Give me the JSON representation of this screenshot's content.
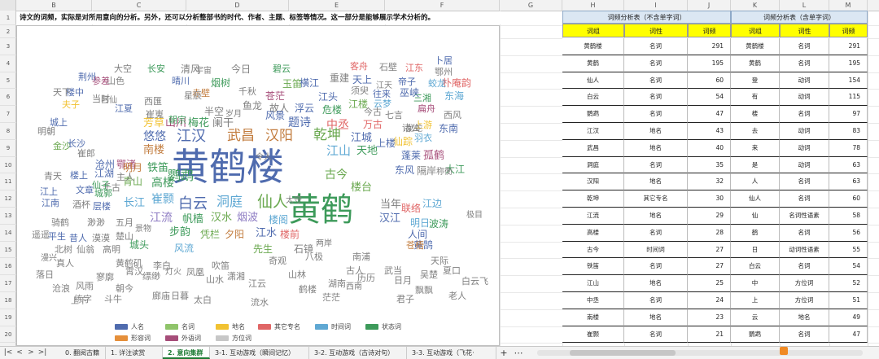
{
  "columns": [
    "B",
    "C",
    "D",
    "E",
    "F",
    "G",
    "H",
    "I",
    "J",
    "K",
    "L",
    "M"
  ],
  "rows": [
    "1",
    "2",
    "3",
    "4",
    "5",
    "6",
    "7",
    "8",
    "9",
    "10",
    "11",
    "12",
    "13",
    "14",
    "15",
    "16",
    "17",
    "18",
    "19",
    "20",
    "21",
    "22"
  ],
  "intro_text": "诗文的词频，实际是对所用意向的分析。另外，还可以分析整部书的时代、作者、主题、标签等情况。这一部分是能够展示学术分析的。",
  "colors": {
    "accent_green": "#1e7b34",
    "header_yellow": "#ffff00",
    "title_blue": "#dbe7f3",
    "word_colors": [
      "#4f6bae",
      "#6aa84f",
      "#f1c232",
      "#e06666",
      "#5fa8d3",
      "#3d9a5a",
      "#a64d79",
      "#8e7cc3",
      "#c27c3e",
      "#808080"
    ]
  },
  "word_cloud": [
    {
      "t": "黄鹤楼",
      "c": "#4f6bae"
    },
    {
      "t": "黄鹤",
      "c": "#3d9a5a"
    },
    {
      "t": "江汉",
      "c": "#4f6bae"
    },
    {
      "t": "武昌",
      "c": "#c27c3e"
    },
    {
      "t": "汉阳",
      "c": "#c27c3e"
    },
    {
      "t": "仙人",
      "c": "#6aa84f"
    },
    {
      "t": "白云",
      "c": "#4f6bae"
    },
    {
      "t": "洞庭",
      "c": "#5fa8d3"
    },
    {
      "t": "乾坤",
      "c": "#6aa84f"
    },
    {
      "t": "鹦鹉",
      "c": "#3d9a5a"
    },
    {
      "t": "江山",
      "c": "#5fa8d3"
    },
    {
      "t": "高楼",
      "c": "#3d9a5a"
    },
    {
      "t": "江流",
      "c": "#8e7cc3"
    },
    {
      "t": "江水",
      "c": "#4f6bae"
    },
    {
      "t": "题诗",
      "c": "#4f6bae"
    },
    {
      "t": "中丞",
      "c": "#e06666"
    },
    {
      "t": "古今",
      "c": "#6aa84f"
    },
    {
      "t": "楼台",
      "c": "#6aa84f"
    },
    {
      "t": "江城",
      "c": "#4f6bae"
    },
    {
      "t": "天地",
      "c": "#3d9a5a"
    },
    {
      "t": "芳草",
      "c": "#f1c232"
    },
    {
      "t": "山川",
      "c": "#a64d79"
    },
    {
      "t": "梅花",
      "c": "#3d9a5a"
    },
    {
      "t": "阑干",
      "c": "#808080"
    },
    {
      "t": "悠悠",
      "c": "#4f6bae"
    },
    {
      "t": "南楼",
      "c": "#c27c3e"
    },
    {
      "t": "铁笛",
      "c": "#3d9a5a"
    },
    {
      "t": "沧州",
      "c": "#4f6bae"
    },
    {
      "t": "鄂渚",
      "c": "#a64d79"
    },
    {
      "t": "长江",
      "c": "#5fa8d3"
    },
    {
      "t": "崔颢",
      "c": "#5fa8d3"
    },
    {
      "t": "明月",
      "c": "#c27c3e"
    },
    {
      "t": "青山",
      "c": "#6aa84f"
    },
    {
      "t": "千古",
      "c": "#808080"
    },
    {
      "t": "江湖",
      "c": "#4f6bae"
    },
    {
      "t": "帆樯",
      "c": "#3d9a5a"
    },
    {
      "t": "汉水",
      "c": "#6aa84f"
    },
    {
      "t": "烟波",
      "c": "#8e7cc3"
    },
    {
      "t": "楼阁",
      "c": "#5fa8d3"
    },
    {
      "t": "步韵",
      "c": "#3d9a5a"
    },
    {
      "t": "凭栏",
      "c": "#6aa84f"
    },
    {
      "t": "夕阳",
      "c": "#c27c3e"
    },
    {
      "t": "先生",
      "c": "#6aa84f"
    },
    {
      "t": "楼前",
      "c": "#e06666"
    },
    {
      "t": "石镜",
      "c": "#808080"
    },
    {
      "t": "风流",
      "c": "#5fa8d3"
    },
    {
      "t": "城头",
      "c": "#3d9a5a"
    },
    {
      "t": "汉江",
      "c": "#4f6bae"
    },
    {
      "t": "明日",
      "c": "#5fa8d3"
    },
    {
      "t": "黄鹄",
      "c": "#4f6bae"
    },
    {
      "t": "当年",
      "c": "#808080"
    },
    {
      "t": "联络",
      "c": "#e06666"
    },
    {
      "t": "苍梧",
      "c": "#c27c3e"
    },
    {
      "t": "江边",
      "c": "#5fa8d3"
    },
    {
      "t": "波涛",
      "c": "#3d9a5a"
    },
    {
      "t": "人间",
      "c": "#4f6bae"
    },
    {
      "t": "东风",
      "c": "#4f6bae"
    },
    {
      "t": "隔岸",
      "c": "#808080"
    },
    {
      "t": "大江",
      "c": "#3d9a5a"
    },
    {
      "t": "孤鹤",
      "c": "#a64d79"
    },
    {
      "t": "蓬莱",
      "c": "#4f6bae"
    },
    {
      "t": "仙踪",
      "c": "#f1c232"
    },
    {
      "t": "上楼",
      "c": "#4f6bae"
    },
    {
      "t": "诸公",
      "c": "#808080"
    },
    {
      "t": "羽衣",
      "c": "#5fa8d3"
    },
    {
      "t": "上游",
      "c": "#f1c232"
    },
    {
      "t": "东南",
      "c": "#4f6bae"
    },
    {
      "t": "万古",
      "c": "#e06666"
    },
    {
      "t": "七言",
      "c": "#808080"
    },
    {
      "t": "今古",
      "c": "#808080"
    },
    {
      "t": "云梦",
      "c": "#5fa8d3"
    },
    {
      "t": "扁舟",
      "c": "#a64d79"
    },
    {
      "t": "西风",
      "c": "#808080"
    },
    {
      "t": "东海",
      "c": "#5fa8d3"
    },
    {
      "t": "朴庵韵",
      "c": "#e06666"
    },
    {
      "t": "三湘",
      "c": "#3d9a5a"
    },
    {
      "t": "巫峡",
      "c": "#4f6bae"
    },
    {
      "t": "往来",
      "c": "#4f6bae"
    },
    {
      "t": "帝子",
      "c": "#4f6bae"
    },
    {
      "t": "蛟龙",
      "c": "#5fa8d3"
    },
    {
      "t": "鄂州",
      "c": "#808080"
    },
    {
      "t": "卜居",
      "c": "#4f6bae"
    },
    {
      "t": "江东",
      "c": "#e06666"
    },
    {
      "t": "石壁",
      "c": "#808080"
    },
    {
      "t": "客舟",
      "c": "#e06666"
    },
    {
      "t": "重建",
      "c": "#808080"
    },
    {
      "t": "天上",
      "c": "#4f6bae"
    },
    {
      "t": "须臾",
      "c": "#808080"
    },
    {
      "t": "江楼",
      "c": "#6aa84f"
    },
    {
      "t": "危楼",
      "c": "#3d9a5a"
    },
    {
      "t": "浮云",
      "c": "#4f6bae"
    },
    {
      "t": "故人",
      "c": "#808080"
    },
    {
      "t": "江头",
      "c": "#4f6bae"
    },
    {
      "t": "横江",
      "c": "#4f6bae"
    },
    {
      "t": "玉笛",
      "c": "#6aa84f"
    },
    {
      "t": "碧云",
      "c": "#3d9a5a"
    },
    {
      "t": "苍茫",
      "c": "#a64d79"
    },
    {
      "t": "千秋",
      "c": "#808080"
    },
    {
      "t": "今日",
      "c": "#808080"
    },
    {
      "t": "鱼龙",
      "c": "#808080"
    },
    {
      "t": "风景",
      "c": "#4f6bae"
    },
    {
      "t": "半空",
      "c": "#808080"
    },
    {
      "t": "烟树",
      "c": "#3d9a5a"
    },
    {
      "t": "清风",
      "c": "#808080"
    },
    {
      "t": "晴川",
      "c": "#4f6bae"
    },
    {
      "t": "赤壁",
      "c": "#c27c3e"
    },
    {
      "t": "朝宗",
      "c": "#3d9a5a"
    },
    {
      "t": "星辰",
      "c": "#808080"
    },
    {
      "t": "西匯",
      "c": "#808080"
    },
    {
      "t": "崔嵬",
      "c": "#808080"
    },
    {
      "t": "长安",
      "c": "#3d9a5a"
    },
    {
      "t": "江夏",
      "c": "#4f6bae"
    },
    {
      "t": "大空",
      "c": "#808080"
    },
    {
      "t": "山色",
      "c": "#808080"
    },
    {
      "t": "参差",
      "c": "#a64d79"
    },
    {
      "t": "荆州",
      "c": "#4f6bae"
    },
    {
      "t": "楼中",
      "c": "#4f6bae"
    },
    {
      "t": "天下",
      "c": "#808080"
    },
    {
      "t": "夫子",
      "c": "#f1c232"
    },
    {
      "t": "当时",
      "c": "#808080"
    },
    {
      "t": "城上",
      "c": "#4f6bae"
    },
    {
      "t": "金沙",
      "c": "#6aa84f"
    },
    {
      "t": "明朝",
      "c": "#808080"
    },
    {
      "t": "长沙",
      "c": "#4f6bae"
    },
    {
      "t": "崔郎",
      "c": "#808080"
    },
    {
      "t": "青天",
      "c": "#808080"
    },
    {
      "t": "楼上",
      "c": "#4f6bae"
    },
    {
      "t": "仙子",
      "c": "#3d9a5a"
    },
    {
      "t": "江上",
      "c": "#4f6bae"
    },
    {
      "t": "城郭",
      "c": "#3d9a5a"
    },
    {
      "t": "主人",
      "c": "#808080"
    },
    {
      "t": "文章",
      "c": "#4f6bae"
    },
    {
      "t": "江南",
      "c": "#4f6bae"
    },
    {
      "t": "酒杯",
      "c": "#808080"
    },
    {
      "t": "层楼",
      "c": "#4f6bae"
    },
    {
      "t": "骑鹤",
      "c": "#808080"
    },
    {
      "t": "渺渺",
      "c": "#808080"
    },
    {
      "t": "五月",
      "c": "#808080"
    },
    {
      "t": "遥遥",
      "c": "#808080"
    },
    {
      "t": "平生",
      "c": "#4f6bae"
    },
    {
      "t": "昔人",
      "c": "#4f6bae"
    },
    {
      "t": "漠漠",
      "c": "#808080"
    },
    {
      "t": "楚山",
      "c": "#808080"
    },
    {
      "t": "北树",
      "c": "#808080"
    },
    {
      "t": "仙翁",
      "c": "#808080"
    },
    {
      "t": "高明",
      "c": "#808080"
    },
    {
      "t": "黄鹤矶",
      "c": "#808080"
    },
    {
      "t": "朝今",
      "c": "#808080"
    },
    {
      "t": "真人",
      "c": "#808080"
    },
    {
      "t": "落日",
      "c": "#808080"
    },
    {
      "t": "沧浪",
      "c": "#808080"
    },
    {
      "t": "风雨",
      "c": "#808080"
    },
    {
      "t": "寥廓",
      "c": "#808080"
    },
    {
      "t": "练字",
      "c": "#808080"
    },
    {
      "t": "斗牛",
      "c": "#808080"
    },
    {
      "t": "霄汉",
      "c": "#808080"
    },
    {
      "t": "缥缈",
      "c": "#808080"
    },
    {
      "t": "廊庙",
      "c": "#808080"
    },
    {
      "t": "日暮",
      "c": "#808080"
    },
    {
      "t": "李白",
      "c": "#808080"
    },
    {
      "t": "凤凰",
      "c": "#808080"
    },
    {
      "t": "山水",
      "c": "#808080"
    },
    {
      "t": "太白",
      "c": "#808080"
    },
    {
      "t": "吹笛",
      "c": "#808080"
    },
    {
      "t": "潇湘",
      "c": "#808080"
    },
    {
      "t": "江云",
      "c": "#808080"
    },
    {
      "t": "流水",
      "c": "#808080"
    },
    {
      "t": "奇观",
      "c": "#808080"
    },
    {
      "t": "山林",
      "c": "#808080"
    },
    {
      "t": "八极",
      "c": "#808080"
    },
    {
      "t": "湖南",
      "c": "#808080"
    },
    {
      "t": "鹤楼",
      "c": "#808080"
    },
    {
      "t": "茫茫",
      "c": "#808080"
    },
    {
      "t": "古人",
      "c": "#808080"
    },
    {
      "t": "南浦",
      "c": "#808080"
    },
    {
      "t": "历历",
      "c": "#808080"
    },
    {
      "t": "武当",
      "c": "#808080"
    },
    {
      "t": "日月",
      "c": "#808080"
    },
    {
      "t": "君子",
      "c": "#808080"
    },
    {
      "t": "吴楚",
      "c": "#808080"
    },
    {
      "t": "飘飘",
      "c": "#808080"
    },
    {
      "t": "天际",
      "c": "#808080"
    },
    {
      "t": "夏口",
      "c": "#808080"
    },
    {
      "t": "白云飞",
      "c": "#808080"
    },
    {
      "t": "老人",
      "c": "#808080"
    },
    {
      "t": "景物",
      "c": "#808080"
    },
    {
      "t": "灯火",
      "c": "#808080"
    },
    {
      "t": "宇宙",
      "c": "#808080"
    },
    {
      "t": "岁月",
      "c": "#808080"
    },
    {
      "t": "令人",
      "c": "#808080"
    },
    {
      "t": "太守",
      "c": "#808080"
    },
    {
      "t": "两岸",
      "c": "#808080"
    },
    {
      "t": "西南",
      "c": "#808080"
    },
    {
      "t": "江天",
      "c": "#808080"
    },
    {
      "t": "龙蛇",
      "c": "#808080"
    },
    {
      "t": "称衡",
      "c": "#808080"
    },
    {
      "t": "极目",
      "c": "#808080"
    },
    {
      "t": "漫兴",
      "c": "#808080"
    },
    {
      "t": "上下",
      "c": "#808080"
    },
    {
      "t": "吕仙",
      "c": "#808080"
    }
  ],
  "legend": [
    {
      "label": "人名",
      "color": "#4f6bae"
    },
    {
      "label": "名词",
      "color": "#8fc46a"
    },
    {
      "label": "地名",
      "color": "#f1c232"
    },
    {
      "label": "其它专名",
      "color": "#e06666"
    },
    {
      "label": "时间词",
      "color": "#5fa8d3"
    },
    {
      "label": "状态词",
      "color": "#3d9a5a"
    },
    {
      "label": "形容词",
      "color": "#e58f3a"
    },
    {
      "label": "外语词",
      "color": "#a64d79"
    },
    {
      "label": "方位词",
      "color": "#c7c7c7"
    }
  ],
  "table1": {
    "title": "词频分析表（不含单字词）",
    "headers": [
      "词组",
      "词性",
      "词频"
    ],
    "rows": [
      [
        "黄鹤楼",
        "名词",
        "291"
      ],
      [
        "黄鹤",
        "名词",
        "195"
      ],
      [
        "仙人",
        "名词",
        "60"
      ],
      [
        "白云",
        "名词",
        "54"
      ],
      [
        "鹦鹉",
        "名词",
        "47"
      ],
      [
        "江汉",
        "地名",
        "43"
      ],
      [
        "武昌",
        "地名",
        "40"
      ],
      [
        "洞庭",
        "名词",
        "35"
      ],
      [
        "汉阳",
        "地名",
        "32"
      ],
      [
        "乾坤",
        "其它专名",
        "30"
      ],
      [
        "江流",
        "地名",
        "29"
      ],
      [
        "高楼",
        "名词",
        "28"
      ],
      [
        "古今",
        "时间词",
        "27"
      ],
      [
        "铁笛",
        "名词",
        "27"
      ],
      [
        "江山",
        "地名",
        "25"
      ],
      [
        "中丞",
        "名词",
        "24"
      ],
      [
        "南楼",
        "地名",
        "23"
      ],
      [
        "崔颢",
        "名词",
        "21"
      ],
      [
        "神仙",
        "名词",
        "20"
      ],
      [
        "悠悠",
        "状态词",
        "20"
      ]
    ]
  },
  "table2": {
    "title": "词频分析表（含单字词）",
    "headers": [
      "词组",
      "词性",
      "词频"
    ],
    "rows": [
      [
        "黄鹤楼",
        "名词",
        "291"
      ],
      [
        "黄鹤",
        "名词",
        "195"
      ],
      [
        "登",
        "动词",
        "154"
      ],
      [
        "有",
        "动词",
        "115"
      ],
      [
        "楼",
        "名词",
        "97"
      ],
      [
        "去",
        "动词",
        "83"
      ],
      [
        "来",
        "动词",
        "78"
      ],
      [
        "是",
        "动词",
        "63"
      ],
      [
        "人",
        "名词",
        "63"
      ],
      [
        "仙人",
        "名词",
        "60"
      ],
      [
        "仙",
        "名词性语素",
        "58"
      ],
      [
        "鹤",
        "名词",
        "56"
      ],
      [
        "日",
        "动词性语素",
        "55"
      ],
      [
        "白云",
        "名词",
        "54"
      ],
      [
        "中",
        "方位词",
        "52"
      ],
      [
        "上",
        "方位词",
        "51"
      ],
      [
        "云",
        "地名",
        "49"
      ],
      [
        "鹦鹉",
        "名词",
        "47"
      ],
      [
        "如",
        "动词",
        "46"
      ],
      [
        "时",
        "名词性语素",
        "44"
      ]
    ]
  },
  "sheet_tabs": [
    {
      "label": "0. 翻阅古籍",
      "active": false
    },
    {
      "label": "1. 详注读赏",
      "active": false
    },
    {
      "label": "2. 意向集群",
      "active": true
    },
    {
      "label": "3-1. 互动游戏（瞬间记忆）",
      "active": false
    },
    {
      "label": "3-2. 互动游戏（古诗对句）",
      "active": false
    },
    {
      "label": "3-3. 互动游戏（飞花·",
      "active": false
    }
  ],
  "nav": {
    "first": "|<",
    "prev": "<",
    "next": ">",
    "last": ">|",
    "add": "+",
    "more": "⋯"
  }
}
